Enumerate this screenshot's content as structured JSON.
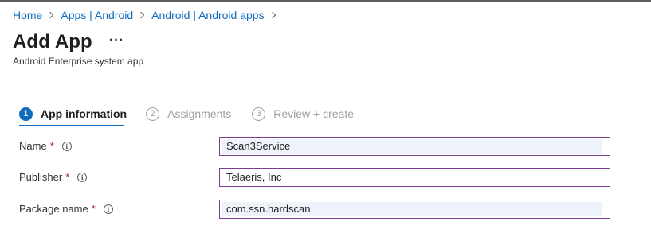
{
  "breadcrumb": [
    {
      "label": "Home"
    },
    {
      "label": "Apps | Android"
    },
    {
      "label": "Android | Android apps"
    }
  ],
  "page": {
    "title": "Add App",
    "more_label": "···",
    "subtitle": "Android Enterprise system app"
  },
  "steps": [
    {
      "number": "1",
      "label": "App information",
      "state": "active"
    },
    {
      "number": "2",
      "label": "Assignments",
      "state": "inactive"
    },
    {
      "number": "3",
      "label": "Review + create",
      "state": "inactive"
    }
  ],
  "form": {
    "name": {
      "label": "Name",
      "required_mark": "*",
      "value": "Scan3Service"
    },
    "publisher": {
      "label": "Publisher",
      "required_mark": "*",
      "value": "Telaeris, Inc"
    },
    "package_name": {
      "label": "Package name",
      "required_mark": "*",
      "value": "com.ssn.hardscan"
    }
  },
  "colors": {
    "link": "#0f6cbd",
    "active_step": "#0f6cbd",
    "required": "#a4262c",
    "field_border": "#7a3d8f",
    "field_autofill": "#eef2fa"
  },
  "icons": {
    "info": "info-icon",
    "separator": "chevron-right-icon"
  }
}
